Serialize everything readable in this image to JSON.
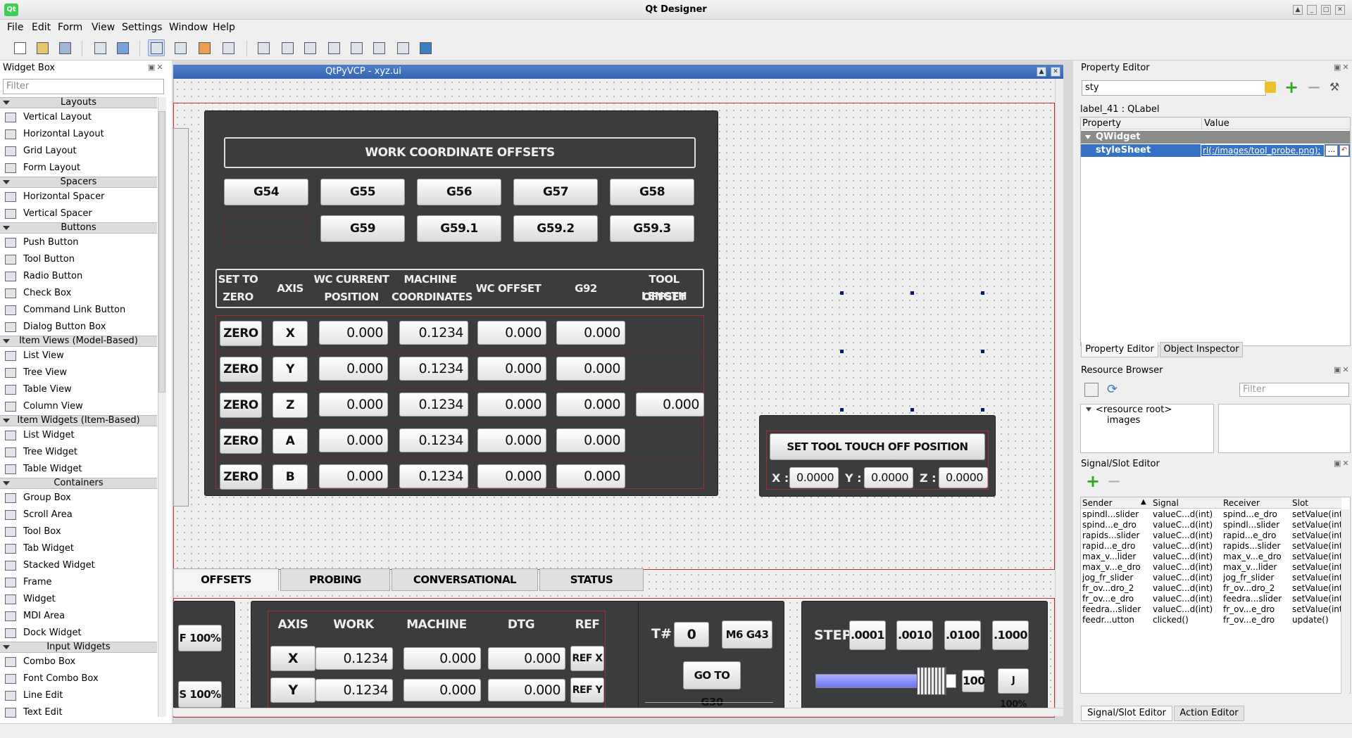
{
  "window": {
    "title": "Qt Designer",
    "logo": "Qt"
  },
  "menu": [
    "File",
    "Edit",
    "Form",
    "View",
    "Settings",
    "Window",
    "Help"
  ],
  "widget_box": {
    "title": "Widget Box",
    "filter_placeholder": "Filter",
    "categories": [
      {
        "label": "Layouts",
        "items": [
          "Vertical Layout",
          "Horizontal Layout",
          "Grid Layout",
          "Form Layout"
        ]
      },
      {
        "label": "Spacers",
        "items": [
          "Horizontal Spacer",
          "Vertical Spacer"
        ]
      },
      {
        "label": "Buttons",
        "items": [
          "Push Button",
          "Tool Button",
          "Radio Button",
          "Check Box",
          "Command Link Button",
          "Dialog Button Box"
        ]
      },
      {
        "label": "Item Views (Model-Based)",
        "items": [
          "List View",
          "Tree View",
          "Table View",
          "Column View"
        ]
      },
      {
        "label": "Item Widgets (Item-Based)",
        "items": [
          "List Widget",
          "Tree Widget",
          "Table Widget"
        ]
      },
      {
        "label": "Containers",
        "items": [
          "Group Box",
          "Scroll Area",
          "Tool Box",
          "Tab Widget",
          "Stacked Widget",
          "Frame",
          "Widget",
          "MDI Area",
          "Dock Widget"
        ]
      },
      {
        "label": "Input Widgets",
        "items": [
          "Combo Box",
          "Font Combo Box",
          "Line Edit",
          "Text Edit"
        ]
      }
    ]
  },
  "form": {
    "title": "QtPyVCP - xyz.ui",
    "wco": {
      "title": "WORK COORDINATE OFFSETS",
      "row1": [
        "G54",
        "G55",
        "G56",
        "G57",
        "G58"
      ],
      "row2": [
        "G59",
        "G59.1",
        "G59.2",
        "G59.3"
      ]
    },
    "offsets_table": {
      "headers": [
        [
          "SET TO",
          "ZERO"
        ],
        [
          "AXIS",
          ""
        ],
        [
          "WC CURRENT",
          "POSITION"
        ],
        [
          "MACHINE",
          "COORDINATES"
        ],
        [
          "WC OFFSET",
          ""
        ],
        [
          "G92",
          ""
        ],
        [
          "TOOL LENGTH",
          "OFFSET"
        ]
      ],
      "zero_label": "ZERO",
      "rows": [
        {
          "axis": "X",
          "wc": "0.000",
          "mach": "0.1234",
          "off": "0.000",
          "g92": "0.000",
          "tlo": ""
        },
        {
          "axis": "Y",
          "wc": "0.000",
          "mach": "0.1234",
          "off": "0.000",
          "g92": "0.000",
          "tlo": ""
        },
        {
          "axis": "Z",
          "wc": "0.000",
          "mach": "0.1234",
          "off": "0.000",
          "g92": "0.000",
          "tlo": "0.000"
        },
        {
          "axis": "A",
          "wc": "0.000",
          "mach": "0.1234",
          "off": "0.000",
          "g92": "0.000",
          "tlo": ""
        },
        {
          "axis": "B",
          "wc": "0.000",
          "mach": "0.1234",
          "off": "0.000",
          "g92": "0.000",
          "tlo": ""
        }
      ]
    },
    "touch_off": {
      "button": "SET TOOL TOUCH OFF POSITION",
      "x_label": "X :",
      "x": "0.0000",
      "y_label": "Y :",
      "y": "0.0000",
      "z_label": "Z :",
      "z": "0.0000"
    },
    "tabs": [
      "OFFSETS",
      "PROBING",
      "CONVERSATIONAL",
      "STATUS"
    ],
    "overrides": {
      "f": "F 100%",
      "s": "S 100%"
    },
    "dro": {
      "headers": [
        "AXIS",
        "WORK",
        "MACHINE",
        "DTG",
        "REF"
      ],
      "rows": [
        {
          "axis": "X",
          "work": "0.1234",
          "mach": "0.000",
          "dtg": "0.000",
          "ref": "REF X"
        },
        {
          "axis": "Y",
          "work": "0.1234",
          "mach": "0.000",
          "dtg": "0.000",
          "ref": "REF Y"
        }
      ]
    },
    "tool": {
      "label": "T#",
      "value": "0",
      "m6": "M6 G43",
      "g30": "GO TO G30"
    },
    "jog": {
      "step_label": "STEP",
      "steps": [
        ".0001",
        ".0010",
        ".0100",
        ".1000"
      ],
      "value": "100",
      "jog_button": "J 100%",
      "slider_fraction": 0.78
    }
  },
  "property_editor": {
    "title": "Property Editor",
    "search": "sty",
    "object": "label_41 : QLabel",
    "col_property": "Property",
    "col_value": "Value",
    "group": "QWidget",
    "prop_name": "styleSheet",
    "prop_value": "rl(:/images/tool_probe.png);",
    "value_btn": "...",
    "tabs": [
      "Property Editor",
      "Object Inspector"
    ]
  },
  "resource_browser": {
    "title": "Resource Browser",
    "filter_placeholder": "Filter",
    "root": "<resource root>",
    "child": "images"
  },
  "signal_slot": {
    "title": "Signal/Slot Editor",
    "headers": [
      "Sender",
      "Signal",
      "Receiver",
      "Slot"
    ],
    "rows": [
      [
        "spindl...slider",
        "valueC...d(int)",
        "spind...e_dro",
        "setValue(int)"
      ],
      [
        "spind...e_dro",
        "valueC...d(int)",
        "spindl...slider",
        "setValue(int)"
      ],
      [
        "rapids...slider",
        "valueC...d(int)",
        "rapid...e_dro",
        "setValue(int)"
      ],
      [
        "rapid...e_dro",
        "valueC...d(int)",
        "rapids...slider",
        "setValue(int)"
      ],
      [
        "max_v...lider",
        "valueC...d(int)",
        "max_v...e_dro",
        "setValue(int)"
      ],
      [
        "max_v...e_dro",
        "valueC...d(int)",
        "max_v...lider",
        "setValue(int)"
      ],
      [
        "jog_fr_slider",
        "valueC...d(int)",
        "jog_fr_slider",
        "setValue(int)"
      ],
      [
        "fr_ov...dro_2",
        "valueC...d(int)",
        "fr_ov...dro_2",
        "setValue(int)"
      ],
      [
        "fr_ov...e_dro",
        "valueC...d(int)",
        "feedra...slider",
        "setValue(int)"
      ],
      [
        "feedra...slider",
        "valueC...d(int)",
        "fr_ov...e_dro",
        "setValue(int)"
      ],
      [
        "feedr...utton",
        "clicked()",
        "fr_ov...e_dro",
        "update()"
      ]
    ],
    "tabs": [
      "Signal/Slot Editor",
      "Action Editor"
    ]
  }
}
